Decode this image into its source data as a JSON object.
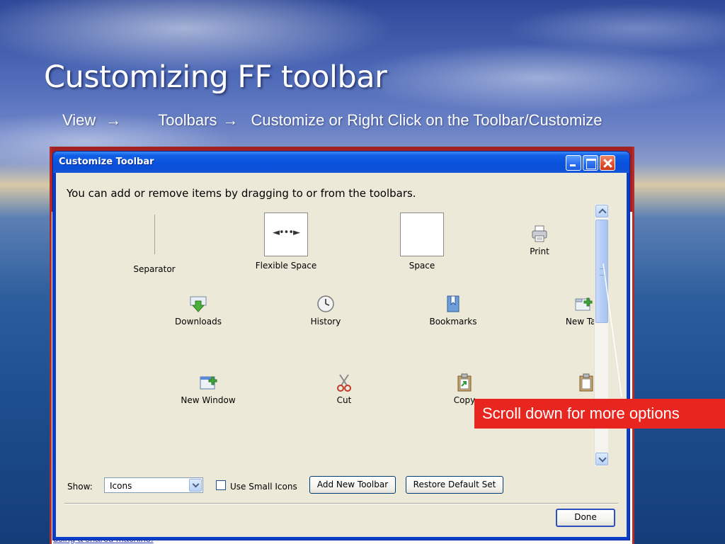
{
  "slide": {
    "title": "Customizing FF toolbar",
    "path": {
      "view": "View",
      "arrow1": "→",
      "toolbars": "Toolbars",
      "arrow2": "→",
      "rest": "Customize or Right Click on the Toolbar/Customize"
    },
    "callout": "Scroll down for more options",
    "background_peek_text": "using a shared machine."
  },
  "dialog": {
    "title": "Customize Toolbar",
    "instruction": "You can add or remove items by dragging to or from the toolbars.",
    "items": [
      {
        "label": "Separator",
        "icon": "separator-line"
      },
      {
        "label": "Flexible Space",
        "icon": "flexible-space-icon",
        "glyph": "◄•••►"
      },
      {
        "label": "Space",
        "icon": "space-box"
      },
      {
        "label": "Print",
        "icon": "printer-icon"
      },
      {
        "label": "Downloads",
        "icon": "download-arrow-icon"
      },
      {
        "label": "History",
        "icon": "clock-icon"
      },
      {
        "label": "Bookmarks",
        "icon": "bookmark-icon"
      },
      {
        "label": "New Tab",
        "icon": "new-tab-icon"
      },
      {
        "label": "New Window",
        "icon": "new-window-icon"
      },
      {
        "label": "Cut",
        "icon": "scissors-icon"
      },
      {
        "label": "Copy",
        "icon": "clipboard-copy-icon"
      },
      {
        "label": "Paste",
        "icon": "clipboard-paste-icon"
      }
    ],
    "show_label": "Show:",
    "show_value": "Icons",
    "small_icons_label": "Use Small Icons",
    "small_icons_checked": false,
    "add_toolbar": "Add New Toolbar",
    "restore_default": "Restore Default Set",
    "done": "Done"
  },
  "colors": {
    "xp_title_blue": "#0a53de",
    "dialog_face": "#ece9d8",
    "callout_red": "#e8251f"
  }
}
